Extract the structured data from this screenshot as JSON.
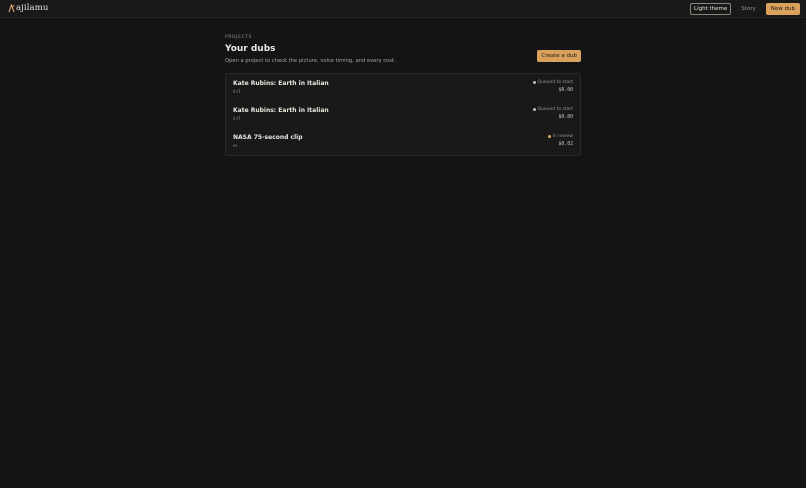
{
  "header": {
    "logo_text": "ajilamu",
    "theme_button": "Light theme",
    "story_button": "Story",
    "new_dub_button": "New dub"
  },
  "page": {
    "eyebrow": "PROJECTS",
    "title": "Your dubs",
    "subtitle": "Open a project to check the picture, voice timing, and every cost.",
    "create_button": "Create a dub"
  },
  "projects": [
    {
      "title": "Kate Rubins: Earth in Italian",
      "lang": "it-IT",
      "status": "Queued to start",
      "status_color": "#b8b3a8",
      "cost": "$0.00"
    },
    {
      "title": "Kate Rubins: Earth in Italian",
      "lang": "it-IT",
      "status": "Queued to start",
      "status_color": "#b8b3a8",
      "cost": "$0.00"
    },
    {
      "title": "NASA 75-second clip",
      "lang": "es",
      "status": "In review",
      "status_color": "#d9a15c",
      "cost": "$0.02"
    }
  ],
  "colors": {
    "accent": "#d9a15c",
    "background": "#141414"
  }
}
